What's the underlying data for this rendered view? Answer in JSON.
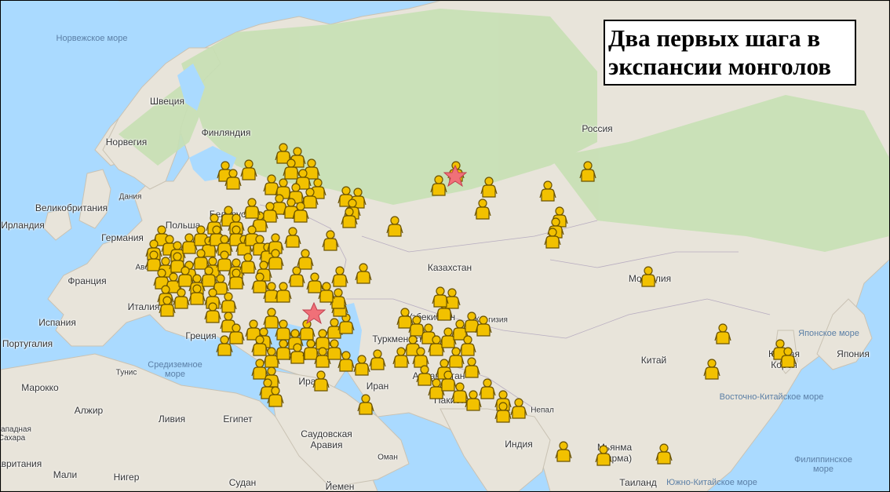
{
  "title": "Два первых шага в экспансии монголов",
  "labels": {
    "norwegian_sea": "Норвежское море",
    "sweden": "Швеция",
    "finland": "Финляндия",
    "norway": "Норвегия",
    "denmark": "Дания",
    "uk": "Великобритания",
    "ireland": "Ирландия",
    "germany": "Германия",
    "poland": "Польша",
    "belarus": "Беларусь",
    "france": "Франция",
    "austria": "Австр",
    "italy": "Италия",
    "spain": "Испания",
    "portugal": "Португалия",
    "greece": "Греция",
    "mediterranean": "Средиземное море",
    "tunisia": "Тунис",
    "morocco": "Марокко",
    "algeria": "Алжир",
    "libya": "Ливия",
    "egypt": "Египет",
    "western_sahara": "Западная Сахара",
    "mauritania": "Мавритания",
    "mali": "Мали",
    "niger": "Нигер",
    "sudan": "Судан",
    "russia": "Россия",
    "kazakhstan": "Казахстан",
    "mongolia": "Монголия",
    "uzbekistan": "Узбекистан",
    "kyrgyzstan": "Киргизия",
    "turkmenistan": "Туркменистан",
    "afghanistan": "Афганистан",
    "iran": "Иран",
    "iraq": "Ирак",
    "saudi": "Саудовская Аравия",
    "oman": "Оман",
    "yemen": "Йемен",
    "pakistan": "Пакистан",
    "nepal": "Непал",
    "india": "Индия",
    "china": "Китай",
    "korea": "Южная Корея",
    "japan": "Япония",
    "sea_of_japan": "Японское море",
    "east_china_sea": "Восточно-Китайское море",
    "philippine_sea": "Филиппинское море",
    "south_china_sea": "Южно-Китайское море",
    "myanmar": "Мьянма (Бирма)",
    "thailand": "Таиланд"
  },
  "colors": {
    "water": "#aadaff",
    "land": "#e8e4da",
    "forest": "#c7e0b4",
    "marker": "#f2c100",
    "star": "#f07078"
  }
}
